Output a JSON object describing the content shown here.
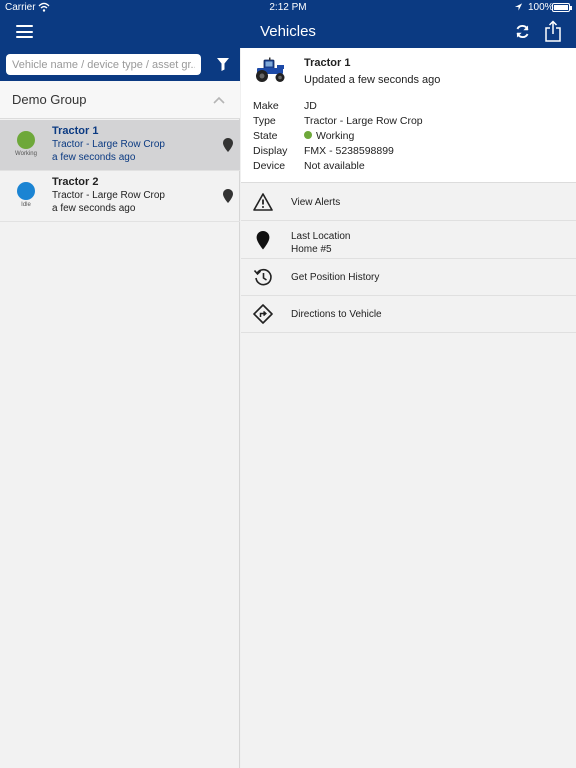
{
  "status_bar": {
    "carrier": "Carrier",
    "time": "2:12 PM",
    "battery": "100%"
  },
  "nav": {
    "title": "Vehicles"
  },
  "search": {
    "placeholder": "Vehicle name / device type / asset gr..."
  },
  "group": {
    "name": "Demo Group"
  },
  "vehicles": [
    {
      "name": "Tractor 1",
      "type": "Tractor - Large Row Crop",
      "updated": "a few seconds ago",
      "state_label": "Working",
      "state_color": "#6ea83a"
    },
    {
      "name": "Tractor 2",
      "type": "Tractor - Large Row Crop",
      "updated": "a few seconds ago",
      "state_label": "Idle",
      "state_color": "#1b84d3"
    }
  ],
  "detail": {
    "name": "Tractor 1",
    "updated": "Updated a few seconds ago",
    "properties": [
      {
        "key": "Make",
        "value": "JD"
      },
      {
        "key": "Type",
        "value": "Tractor - Large Row Crop"
      },
      {
        "key": "State",
        "value": "Working"
      },
      {
        "key": "Display",
        "value": "FMX - 5238598899"
      },
      {
        "key": "Device",
        "value": "Not available"
      }
    ]
  },
  "actions": [
    {
      "label": "View Alerts",
      "icon": "warning-icon"
    },
    {
      "label": "Last Location",
      "sublabel": "Home #5",
      "icon": "location-pin-icon"
    },
    {
      "label": "Get Position History",
      "icon": "history-icon"
    },
    {
      "label": "Directions to Vehicle",
      "icon": "directions-icon"
    }
  ],
  "colors": {
    "brand": "#0b3a82",
    "working": "#6ea83a",
    "idle": "#1b84d3"
  }
}
